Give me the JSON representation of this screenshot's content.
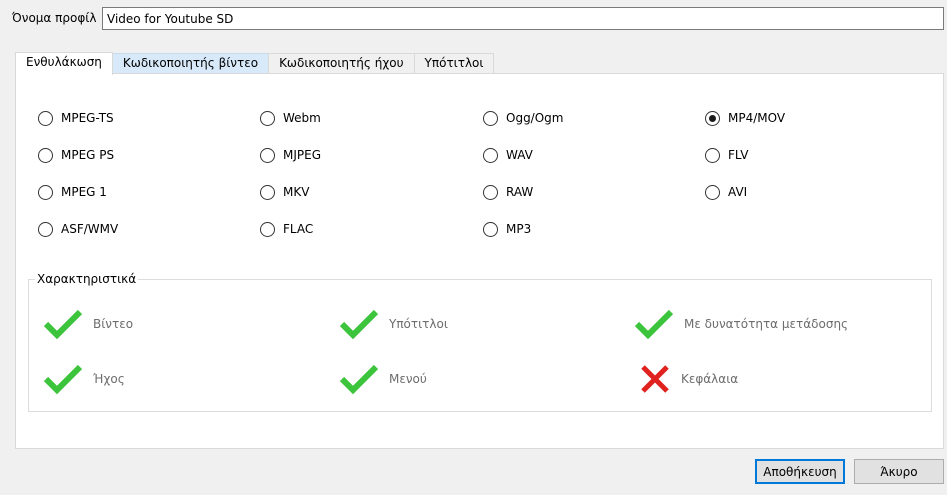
{
  "profile": {
    "label": "Όνομα προφίλ",
    "value": "Video for Youtube SD"
  },
  "tabs": [
    {
      "label": "Ενθυλάκωση"
    },
    {
      "label": "Κωδικοποιητής βίντεο"
    },
    {
      "label": "Κωδικοποιητής ήχου"
    },
    {
      "label": "Υπότιτλοι"
    }
  ],
  "encapsulation": {
    "options": [
      "MPEG-TS",
      "Webm",
      "Ogg/Ogm",
      "MP4/MOV",
      "MPEG PS",
      "MJPEG",
      "WAV",
      "FLV",
      "MPEG 1",
      "MKV",
      "RAW",
      "AVI",
      "ASF/WMV",
      "FLAC",
      "MP3"
    ],
    "selected": "MP4/MOV"
  },
  "features": {
    "title": "Χαρακτηριστικά",
    "items": [
      {
        "label": "Βίντεο",
        "supported": true
      },
      {
        "label": "Υπότιτλοι",
        "supported": true
      },
      {
        "label": "Με δυνατότητα μετάδοσης",
        "supported": true
      },
      {
        "label": "Ήχος",
        "supported": true
      },
      {
        "label": "Μενού",
        "supported": true
      },
      {
        "label": "Κεφάλαια",
        "supported": false
      }
    ],
    "colors": {
      "check": "#3cc43c",
      "cross": "#e0221f"
    }
  },
  "buttons": {
    "save": "Αποθήκευση",
    "cancel": "Άκυρο"
  }
}
